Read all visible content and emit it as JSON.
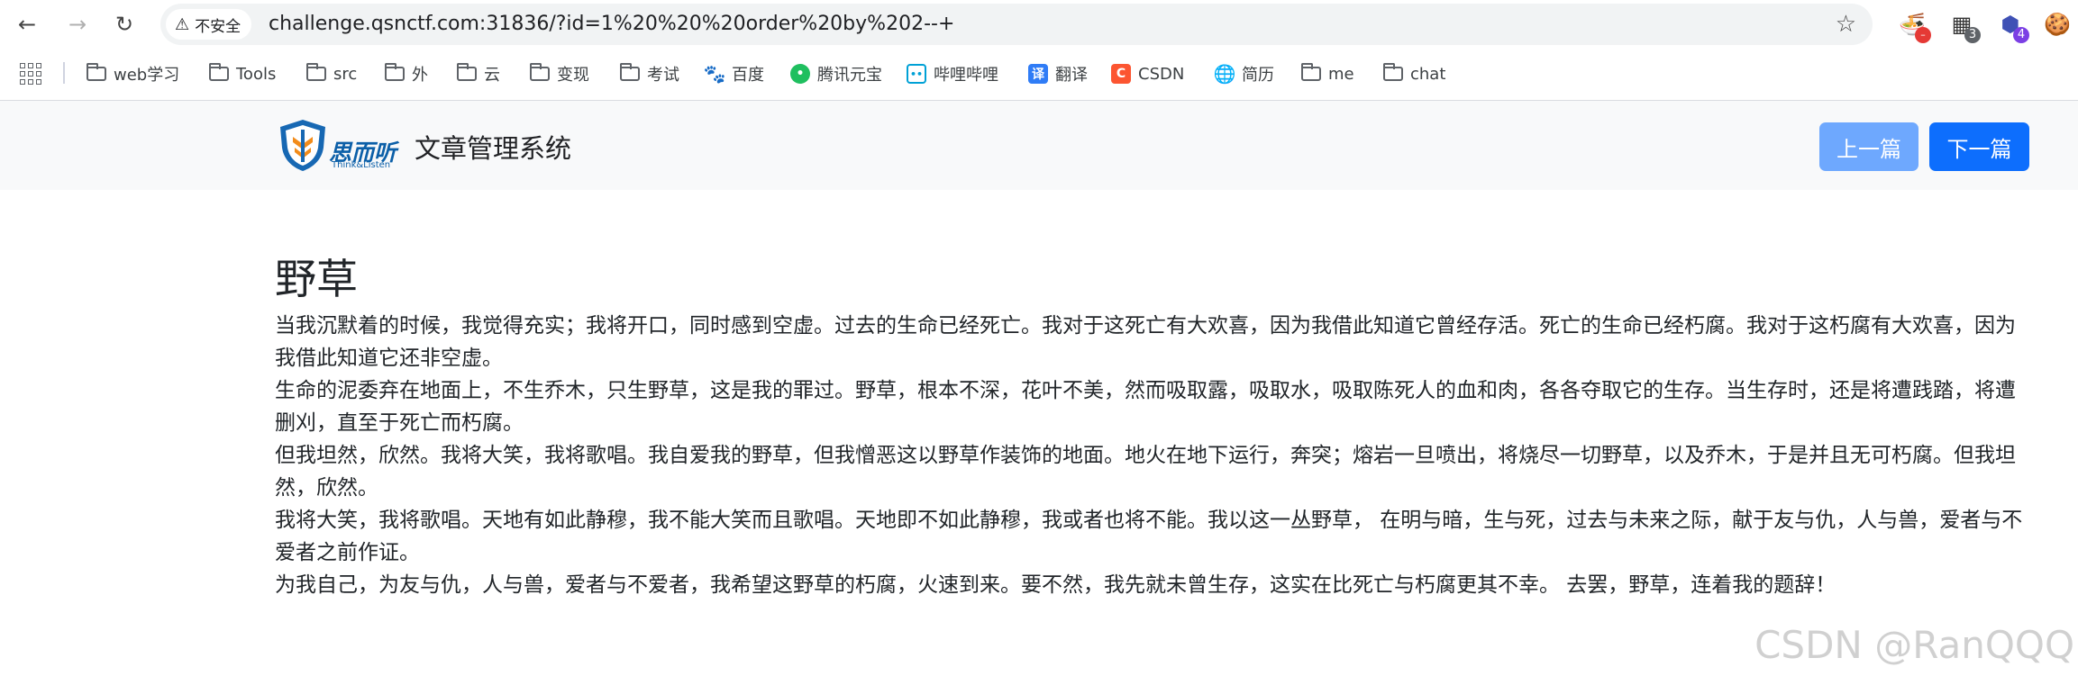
{
  "browser": {
    "security_label": "不安全",
    "url": "challenge.qsnctf.com:31836/?id=1%20%20%20order%20by%202--+",
    "extension_badges": [
      "3",
      "4"
    ],
    "bookmarks": [
      {
        "label": "web学习",
        "icon": "folder-icon"
      },
      {
        "label": "Tools",
        "icon": "folder-icon"
      },
      {
        "label": "src",
        "icon": "folder-icon"
      },
      {
        "label": "外",
        "icon": "folder-icon"
      },
      {
        "label": "云",
        "icon": "folder-icon"
      },
      {
        "label": "变现",
        "icon": "folder-icon"
      },
      {
        "label": "考试",
        "icon": "folder-icon"
      },
      {
        "label": "百度",
        "icon": "baidu-icon"
      },
      {
        "label": "腾讯元宝",
        "icon": "yuanbao-icon"
      },
      {
        "label": "哔哩哔哩",
        "icon": "bilibili-icon"
      },
      {
        "label": "翻译",
        "icon": "translate-icon"
      },
      {
        "label": "CSDN",
        "icon": "csdn-icon"
      },
      {
        "label": "简历",
        "icon": "globe-icon"
      },
      {
        "label": "me",
        "icon": "folder-icon"
      },
      {
        "label": "chat",
        "icon": "folder-icon"
      }
    ],
    "bookmark_icon_glyphs": {
      "translate": "译",
      "csdn": "C"
    }
  },
  "site": {
    "logo_text": "思而听",
    "logo_subtext": "Think&Listen",
    "title": "文章管理系统",
    "prev_button": "上一篇",
    "next_button": "下一篇"
  },
  "article": {
    "title": "野草",
    "paragraphs": [
      "当我沉默着的时候，我觉得充实；我将开口，同时感到空虚。过去的生命已经死亡。我对于这死亡有大欢喜，因为我借此知道它曾经存活。死亡的生命已经朽腐。我对于这朽腐有大欢喜，因为我借此知道它还非空虚。",
      "生命的泥委弃在地面上，不生乔木，只生野草，这是我的罪过。野草，根本不深，花叶不美，然而吸取露，吸取水，吸取陈死人的血和肉，各各夺取它的生存。当生存时，还是将遭践踏，将遭删刈，直至于死亡而朽腐。",
      "但我坦然，欣然。我将大笑，我将歌唱。我自爱我的野草，但我憎恶这以野草作装饰的地面。地火在地下运行，奔突；熔岩一旦喷出，将烧尽一切野草，以及乔木，于是并且无可朽腐。但我坦然，欣然。",
      "我将大笑，我将歌唱。天地有如此静穆，我不能大笑而且歌唱。天地即不如此静穆，我或者也将不能。我以这一丛野草， 在明与暗，生与死，过去与未来之际，献于友与仇，人与兽，爱者与不爱者之前作证。",
      "为我自己，为友与仇，人与兽，爱者与不爱者，我希望这野草的朽腐，火速到来。要不然，我先就未曾生存，这实在比死亡与朽腐更其不幸。 去罢，野草，连着我的题辞！"
    ]
  },
  "watermark": "CSDN @RanQQQ",
  "colors": {
    "primary": "#0d6efd",
    "primary_light": "#6ea8fe",
    "navbar_bg": "#f8f9fa"
  }
}
